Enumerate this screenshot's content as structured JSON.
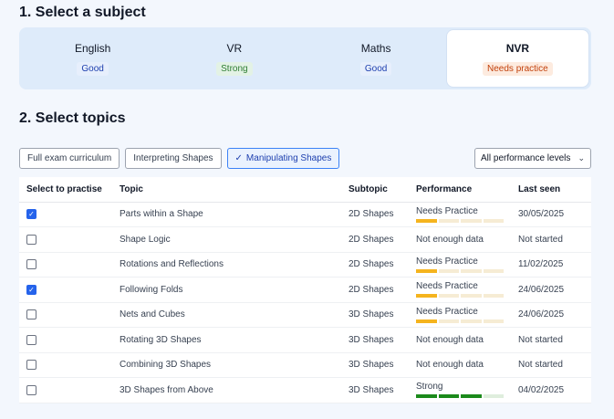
{
  "section1_title": "1. Select a subject",
  "section2_title": "2. Select topics",
  "subjects": [
    {
      "name": "English",
      "status": "Good",
      "kind": "good",
      "active": false
    },
    {
      "name": "VR",
      "status": "Strong",
      "kind": "strong",
      "active": false
    },
    {
      "name": "Maths",
      "status": "Good",
      "kind": "good",
      "active": false
    },
    {
      "name": "NVR",
      "status": "Needs practice",
      "kind": "needs",
      "active": true
    }
  ],
  "filters": [
    {
      "label": "Full exam curriculum",
      "active": false
    },
    {
      "label": "Interpreting Shapes",
      "active": false
    },
    {
      "label": "Manipulating Shapes",
      "active": true
    }
  ],
  "levels_select": "All performance levels",
  "table": {
    "headers": [
      "Select to practise",
      "Topic",
      "Subtopic",
      "Performance",
      "Last seen"
    ],
    "rows": [
      {
        "checked": true,
        "topic": "Parts within a Shape",
        "subtopic": "2D Shapes",
        "performance": "Needs Practice",
        "level": 0.25,
        "last_seen": "30/05/2025"
      },
      {
        "checked": false,
        "topic": "Shape Logic",
        "subtopic": "2D Shapes",
        "performance": "Not enough data",
        "level": null,
        "last_seen": "Not started"
      },
      {
        "checked": false,
        "topic": "Rotations and Reflections",
        "subtopic": "2D Shapes",
        "performance": "Needs Practice",
        "level": 0.25,
        "last_seen": "11/02/2025"
      },
      {
        "checked": true,
        "topic": "Following Folds",
        "subtopic": "2D Shapes",
        "performance": "Needs Practice",
        "level": 0.25,
        "last_seen": "24/06/2025"
      },
      {
        "checked": false,
        "topic": "Nets and Cubes",
        "subtopic": "3D Shapes",
        "performance": "Needs Practice",
        "level": 0.25,
        "last_seen": "24/06/2025"
      },
      {
        "checked": false,
        "topic": "Rotating 3D Shapes",
        "subtopic": "3D Shapes",
        "performance": "Not enough data",
        "level": null,
        "last_seen": "Not started"
      },
      {
        "checked": false,
        "topic": "Combining 3D Shapes",
        "subtopic": "3D Shapes",
        "performance": "Not enough data",
        "level": null,
        "last_seen": "Not started"
      },
      {
        "checked": false,
        "topic": "3D Shapes from Above",
        "subtopic": "3D Shapes",
        "performance": "Strong",
        "level": 0.75,
        "last_seen": "04/02/2025"
      }
    ]
  },
  "colors": {
    "needs": "#f5b41e",
    "strong": "#1b8a1b",
    "accent": "#2563eb"
  }
}
